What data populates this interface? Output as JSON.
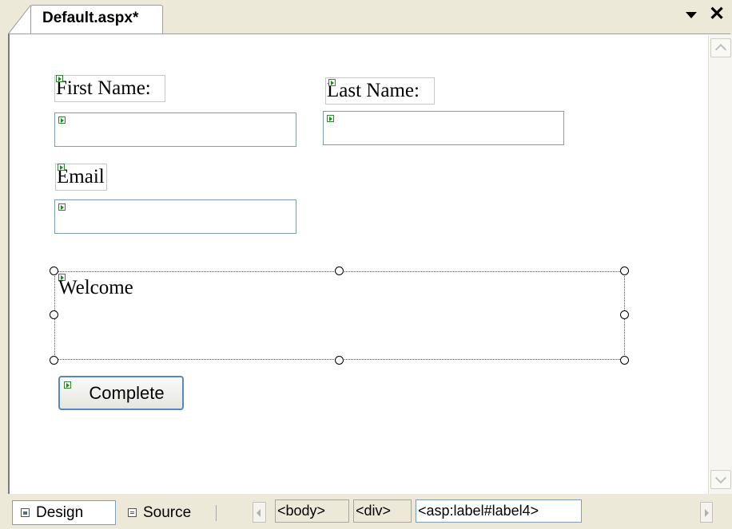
{
  "document_tab": {
    "title": "Default.aspx*"
  },
  "form": {
    "first_name_label": "First Name:",
    "last_name_label": "Last Name:",
    "email_label": "Email",
    "welcome_text": "Welcome",
    "complete_button": "Complete"
  },
  "bottom_bar": {
    "design_label": "Design",
    "source_label": "Source",
    "breadcrumbs": [
      "<body>",
      "<div>",
      "<asp:label#label4>"
    ]
  },
  "icons": [
    "dropdown-arrow-icon",
    "close-icon",
    "scroll-up-icon",
    "scroll-down-icon",
    "smart-tag-glyph-icon",
    "design-view-icon",
    "source-view-icon",
    "scroll-left-icon",
    "scroll-right-icon"
  ]
}
